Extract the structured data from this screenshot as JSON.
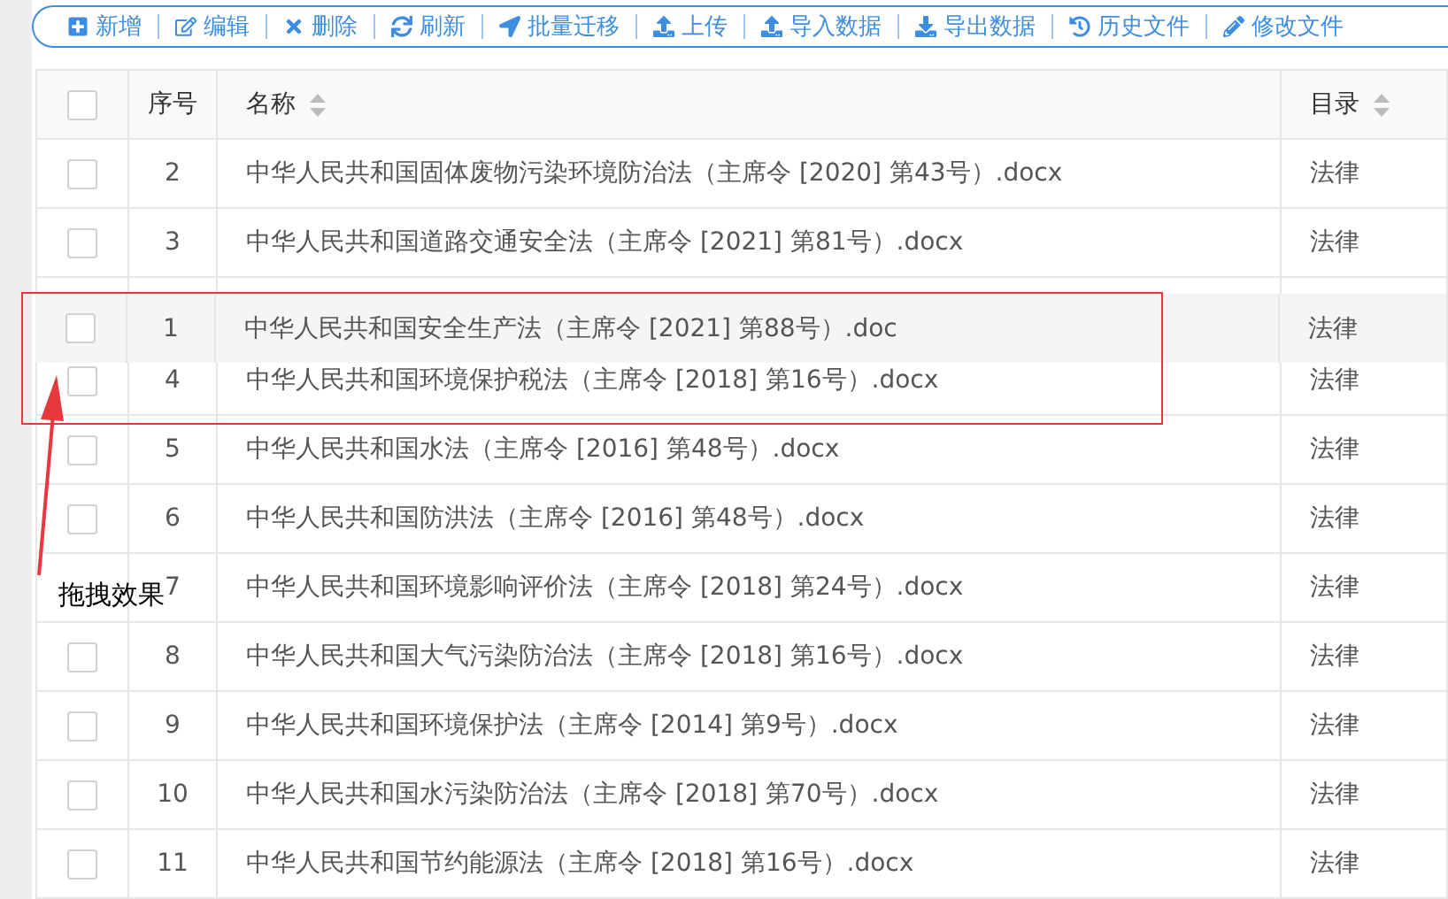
{
  "toolbar": [
    {
      "label": "新增"
    },
    {
      "label": "编辑"
    },
    {
      "label": "删除"
    },
    {
      "label": "刷新"
    },
    {
      "label": "批量迁移"
    },
    {
      "label": "上传"
    },
    {
      "label": "导入数据"
    },
    {
      "label": "导出数据"
    },
    {
      "label": "历史文件"
    },
    {
      "label": "修改文件"
    }
  ],
  "table": {
    "columns": [
      {
        "kind": "checkbox",
        "checked": false
      },
      {
        "kind": "text",
        "label": "序号"
      },
      {
        "kind": "sortable",
        "label": "名称"
      },
      {
        "kind": "sortable",
        "label": "目录"
      }
    ],
    "rows": [
      {
        "kind": "row",
        "index": "2",
        "name": "中华人民共和国固体废物污染环境防治法（主席令 [2020] 第43号）.docx",
        "category": "法律",
        "checked": false
      },
      {
        "kind": "row",
        "index": "3",
        "name": "中华人民共和国道路交通安全法（主席令 [2021] 第81号）.docx",
        "category": "法律",
        "checked": false
      },
      {
        "kind": "drop-slot"
      },
      {
        "kind": "row",
        "index": "4",
        "name": "中华人民共和国环境保护税法（主席令 [2018] 第16号）.docx",
        "category": "法律",
        "checked": false
      },
      {
        "kind": "row",
        "index": "5",
        "name": "中华人民共和国水法（主席令 [2016] 第48号）.docx",
        "category": "法律",
        "checked": false
      },
      {
        "kind": "row",
        "index": "6",
        "name": "中华人民共和国防洪法（主席令 [2016] 第48号）.docx",
        "category": "法律",
        "checked": false
      },
      {
        "kind": "row",
        "index": "7",
        "name": "中华人民共和国环境影响评价法（主席令 [2018] 第24号）.docx",
        "category": "法律"
      },
      {
        "kind": "row",
        "index": "8",
        "name": "中华人民共和国大气污染防治法（主席令 [2018] 第16号）.docx",
        "category": "法律",
        "checked": false
      },
      {
        "kind": "row",
        "index": "9",
        "name": "中华人民共和国环境保护法（主席令 [2014] 第9号）.docx",
        "category": "法律",
        "checked": false
      },
      {
        "kind": "row",
        "index": "10",
        "name": "中华人民共和国水污染防治法（主席令 [2018] 第70号）.docx",
        "category": "法律",
        "checked": false
      },
      {
        "kind": "row",
        "index": "11",
        "name": "中华人民共和国节约能源法（主席令 [2018] 第16号）.docx",
        "category": "法律",
        "checked": false
      }
    ],
    "drag_preview": {
      "index": "1",
      "name": "中华人民共和国安全生产法（主席令 [2021] 第88号）.doc",
      "category": "法律",
      "checked": false
    }
  },
  "annotation": {
    "label": "拖拽效果"
  }
}
